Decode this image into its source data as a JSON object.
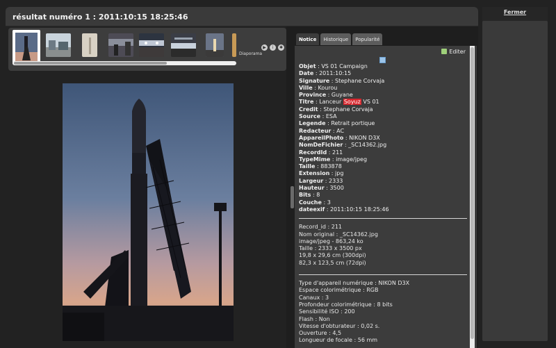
{
  "header": {
    "title": "résultat numéro 1 : 2011:10:15 18:25:46"
  },
  "filmstrip": {
    "slideshow_label": "Diaporama",
    "selected_index": 0
  },
  "close_label": "Fermer",
  "tabs": [
    {
      "label": "Notice"
    },
    {
      "label": "Historique"
    },
    {
      "label": "Popularité"
    }
  ],
  "edit_label": "Editer",
  "notice": {
    "fields": [
      {
        "label": "Objet",
        "value": "VS 01 Campaign"
      },
      {
        "label": "Date",
        "value": "2011:10:15"
      },
      {
        "label": "Signature",
        "value": "Stephane Corvaja"
      },
      {
        "label": "Ville",
        "value": "Kourou"
      },
      {
        "label": "Province",
        "value": "Guyane"
      },
      {
        "label": "Titre",
        "value_pre": "Lanceur",
        "value_highlight": "Soyuz",
        "value_post": "VS 01"
      },
      {
        "label": "Credit",
        "value": "Stephane Corvaja"
      },
      {
        "label": "Source",
        "value": "ESA"
      },
      {
        "label": "Legende",
        "value": "Retrait portique"
      },
      {
        "label": "Redacteur",
        "value": "AC"
      },
      {
        "label": "AppareilPhoto",
        "value": "NIKON D3X"
      },
      {
        "label": "NomDeFichier",
        "value": "_SC14362.jpg"
      },
      {
        "label": "RecordId",
        "value": "211"
      },
      {
        "label": "TypeMime",
        "value": "image/jpeg"
      },
      {
        "label": "Taille",
        "value": "883878"
      },
      {
        "label": "Extension",
        "value": "jpg"
      },
      {
        "label": "Largeur",
        "value": "2333"
      },
      {
        "label": "Hauteur",
        "value": "3500"
      },
      {
        "label": "Bits",
        "value": "8"
      },
      {
        "label": "Couche",
        "value": "3"
      },
      {
        "label": "dateexif",
        "value": "2011:10:15 18:25:46"
      }
    ],
    "file_info": [
      "Record_id : 211",
      "Nom original : _SC14362.jpg",
      "image/jpeg - 863,24 ko",
      "Taille : 2333 x 3500 px",
      "19,8 x 29,6 cm (300dpi)",
      "82,3 x 123,5 cm (72dpi)"
    ],
    "camera_info": [
      "Type d'appareil numérique : NIKON D3X",
      "Espace colorimétrique : RGB",
      "Canaux : 3",
      "Profondeur colorimétrique : 8 bits",
      "Sensibilité ISO : 200",
      "Flash : Non",
      "Vitesse d'obturateur : 0,02 s.",
      "Ouverture : 4,5",
      "Longueur de focale : 56 mm"
    ]
  },
  "colors": {
    "highlight": "#d7262d",
    "panel": "#3c3c3c",
    "background": "#222222"
  }
}
